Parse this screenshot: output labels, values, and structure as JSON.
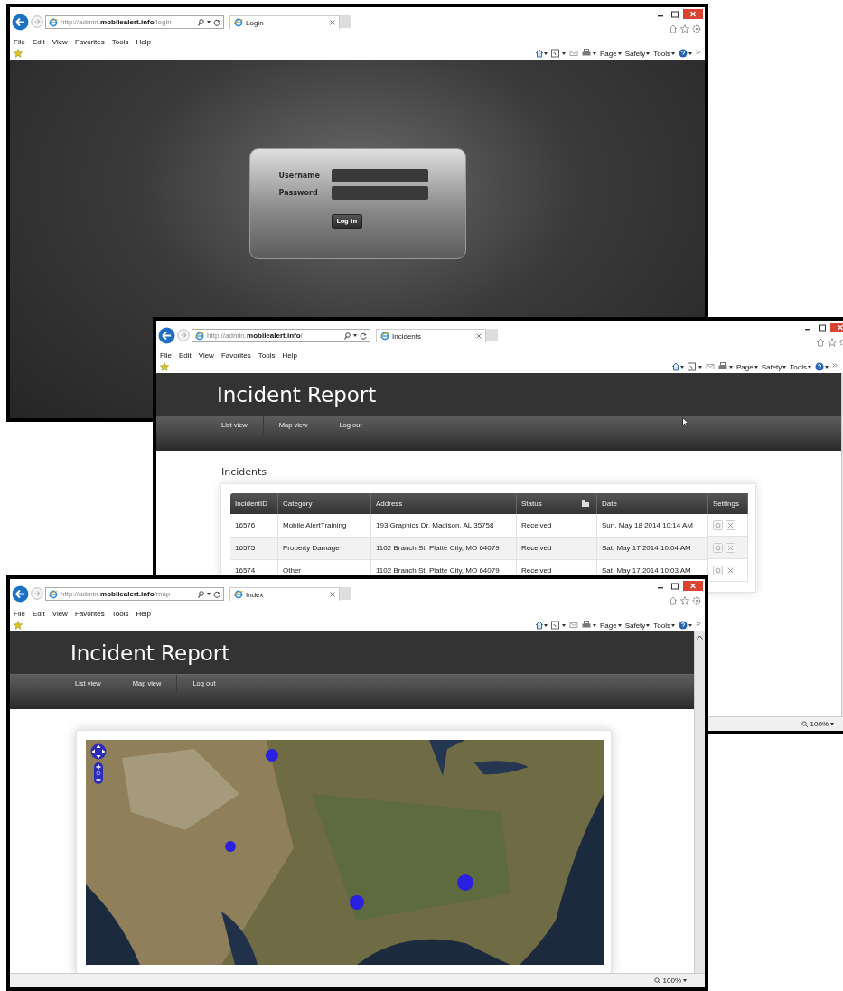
{
  "windows": [
    {
      "kind": "login",
      "url": "http://admin.**mobilealert.info**/login",
      "tab": "Login",
      "menu": [
        "File",
        "Edit",
        "View",
        "Favorites",
        "Tools",
        "Help"
      ],
      "commands": [
        "Page",
        "Safety",
        "Tools"
      ],
      "login": {
        "fields": [
          {
            "label": "Username"
          },
          {
            "label": "Password"
          }
        ],
        "button": "Log In"
      }
    },
    {
      "kind": "list",
      "url": "http://admin.**mobilealert.info**/",
      "tab": "Incidents",
      "menu": [
        "File",
        "Edit",
        "View",
        "Favorites",
        "Tools",
        "Help"
      ],
      "commands": [
        "Page",
        "Safety",
        "Tools"
      ],
      "header": {
        "title": "Incident Report",
        "nav": [
          "List view",
          "Map view",
          "Log out"
        ]
      },
      "section_title": "Incidents",
      "table": {
        "columns": [
          {
            "label": "IncidentID",
            "sort": false
          },
          {
            "label": "Category",
            "sort": false
          },
          {
            "label": "Address",
            "sort": false
          },
          {
            "label": "Status",
            "sort": true
          },
          {
            "label": "Date",
            "sort": false
          },
          {
            "label": "Settings",
            "sort": false
          }
        ],
        "rows": [
          {
            "cells": [
              "16576",
              "Mobile AlertTraining",
              "193 Graphics Dr, Madison, AL 35758",
              "Received",
              "Sun, May 18 2014 10:14 AM"
            ]
          },
          {
            "cells": [
              "16575",
              "Property Damage",
              "1102 Branch St, Platte City, MO 64079",
              "Received",
              "Sat, May 17 2014 10:04 AM"
            ]
          },
          {
            "cells": [
              "16574",
              "Other",
              "1102 Branch St, Platte City, MO 64079",
              "Received",
              "Sat, May 17 2014 10:03 AM"
            ]
          }
        ]
      },
      "status_bar": {
        "zoom": "100%"
      }
    },
    {
      "kind": "map",
      "url": "http://admin.**mobilealert.info**/map",
      "tab": "Index",
      "menu": [
        "File",
        "Edit",
        "View",
        "Favorites",
        "Tools",
        "Help"
      ],
      "commands": [
        "Page",
        "Safety",
        "Tools"
      ],
      "header": {
        "title": "Incident Report",
        "nav": [
          "List view",
          "Map view",
          "Log out"
        ]
      },
      "status_bar": {
        "zoom": "100%"
      }
    }
  ]
}
